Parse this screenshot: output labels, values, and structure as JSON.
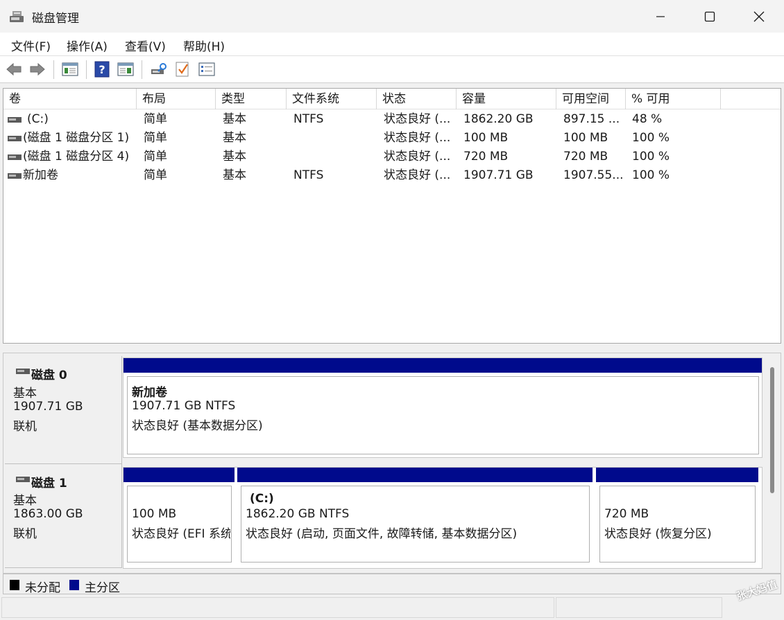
{
  "window": {
    "title": "磁盘管理"
  },
  "menu": [
    "文件(F)",
    "操作(A)",
    "查看(V)",
    "帮助(H)"
  ],
  "toolbar": [
    "back-icon",
    "forward-icon",
    "list-view-icon",
    "help-icon",
    "properties-icon",
    "rescan-icon",
    "checklist-icon",
    "settings-list-icon"
  ],
  "list": {
    "columns": [
      "卷",
      "布局",
      "类型",
      "文件系统",
      "状态",
      "容量",
      "可用空间",
      "% 可用"
    ],
    "rows": [
      [
        "(C:)",
        "简单",
        "基本",
        "NTFS",
        "状态良好 (...",
        "1862.20 GB",
        "897.15 ...",
        "48 %"
      ],
      [
        "(磁盘 1 磁盘分区 1)",
        "简单",
        "基本",
        "",
        "状态良好 (...",
        "100 MB",
        "100 MB",
        "100 %"
      ],
      [
        "(磁盘 1 磁盘分区 4)",
        "简单",
        "基本",
        "",
        "状态良好 (...",
        "720 MB",
        "720 MB",
        "100 %"
      ],
      [
        "新加卷",
        "简单",
        "基本",
        "NTFS",
        "状态良好 (...",
        "1907.71 GB",
        "1907.55...",
        "100 %"
      ]
    ]
  },
  "disks": [
    {
      "name": "磁盘 0",
      "type": "基本",
      "size": "1907.71 GB",
      "status": "联机",
      "partitions": [
        {
          "title": "新加卷",
          "line1": "1907.71 GB NTFS",
          "line2": "状态良好 (基本数据分区)"
        }
      ]
    },
    {
      "name": "磁盘 1",
      "type": "基本",
      "size": "1863.00 GB",
      "status": "联机",
      "partitions": [
        {
          "title": "",
          "line1": "100 MB",
          "line2": "状态良好 (EFI 系统"
        },
        {
          "title": "(C:)",
          "line1": "1862.20 GB NTFS",
          "line2": "状态良好 (启动, 页面文件, 故障转储, 基本数据分区)"
        },
        {
          "title": "",
          "line1": "720 MB",
          "line2": "状态良好 (恢复分区)"
        }
      ]
    }
  ],
  "legend": [
    {
      "label": "未分配",
      "color": "#000000"
    },
    {
      "label": "主分区",
      "color": "#000a8c"
    }
  ],
  "watermark": "张大妈值",
  "colors": {
    "primary_partition": "#000a8c",
    "unallocated": "#000000"
  }
}
